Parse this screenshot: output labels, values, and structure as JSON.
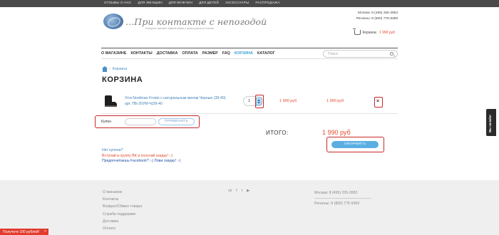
{
  "top_nav": [
    "ОТЗЫВЫ О НАС",
    "ДЛЯ ЖЕНЩИН",
    "ДЛЯ МУЖЧИН",
    "ДЛЯ ДЕТЕЙ",
    "АКСЕССУАРЫ",
    "РАСПРОДАЖА"
  ],
  "logo": {
    "text": "...При контакте с непогодой",
    "subtitle": "Интернет-магазин зимней обуви и аксессуаров из Англии"
  },
  "contacts": {
    "moscow": "Москва: 8 (495) 255-3953",
    "regions": "Регионы: 8 (800) 775-9369"
  },
  "cart": {
    "label": "Корзина:",
    "sum": "1 990 руб"
  },
  "menu": {
    "items": [
      "О МАГАЗИНЕ",
      "КОНТАКТЫ",
      "ДОСТАВКА",
      "ОПЛАТА",
      "РАЗМЕР",
      "FAQ",
      "КОРЗИНА",
      "КАТАЛОГ"
    ],
    "active_index": 6
  },
  "search": {
    "placeholder": "Поиск"
  },
  "breadcrumb": {
    "sep": "›",
    "current": "Корзина"
  },
  "page_title": "КОРЗИНА",
  "cart_item": {
    "name": "Угги Nordman Frosto с натуральным мехом Черные (39-40)",
    "article": "арт. ПБ-20УМ-Ч(39-40",
    "quantity": "1",
    "price": "1 990 руб",
    "total": "1 990 руб",
    "remove": "×"
  },
  "coupon": {
    "label": "Купон",
    "input_value": "",
    "apply_label": "ПРИМЕНИТЬ"
  },
  "total": {
    "label": "ИТОГО:",
    "sum": "1 990 руб"
  },
  "checkout_label": "ОФОРМИТЬ",
  "links": {
    "no_coupon": "Нет купона?",
    "vk": "Вступай в группу ВК и получай скидку! :-)",
    "facebook": "Предпочитаешь Facebook? ;-) Лови скидку! :-)"
  },
  "side_tab": "Мы онлайн!",
  "footer": {
    "links": [
      "О магазине",
      "Контакты",
      "Возврат/Обмен товара",
      "Служба поддержки",
      "Доставка",
      "Оплата"
    ],
    "social": [
      "vk",
      "f",
      "t",
      "▶"
    ],
    "moscow": "Москва: 8 (495) 255-3953",
    "regions": "Регионы: 8 (800) 775-9369"
  },
  "promo": {
    "text": "Получите 100 рублей!",
    "close": "×"
  },
  "colors": {
    "accent": "#3aa0d8",
    "price": "#e24a2b",
    "highlight": "#c62828",
    "button": "#5aaee3"
  }
}
